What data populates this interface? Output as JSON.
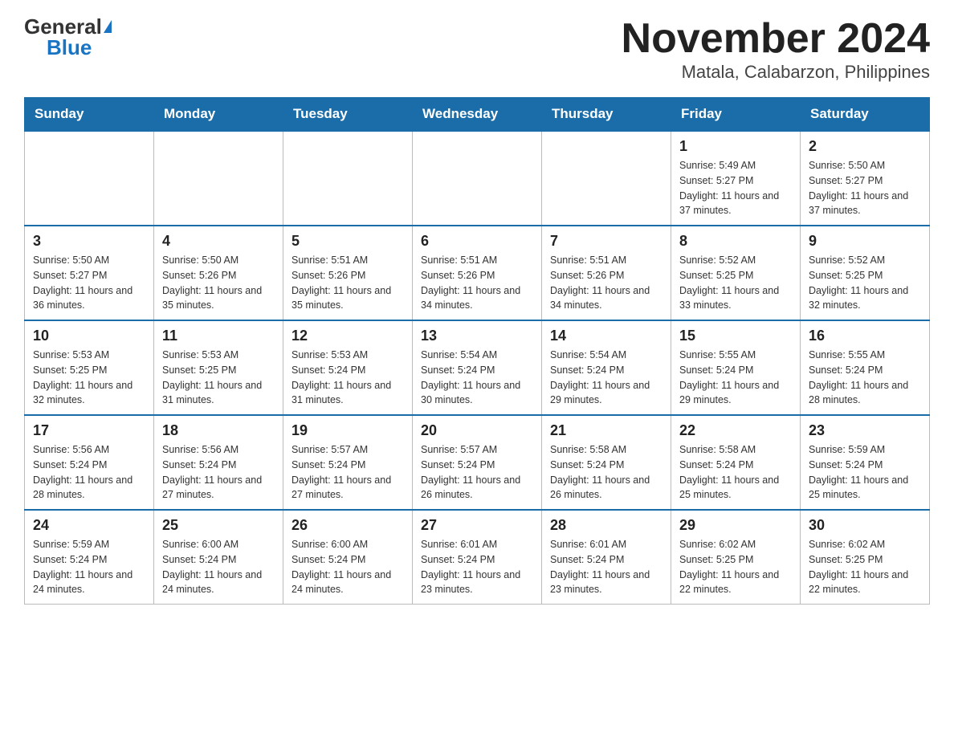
{
  "header": {
    "logo_general": "General",
    "logo_blue": "Blue",
    "title": "November 2024",
    "location": "Matala, Calabarzon, Philippines"
  },
  "weekdays": [
    "Sunday",
    "Monday",
    "Tuesday",
    "Wednesday",
    "Thursday",
    "Friday",
    "Saturday"
  ],
  "weeks": [
    [
      {
        "day": "",
        "info": ""
      },
      {
        "day": "",
        "info": ""
      },
      {
        "day": "",
        "info": ""
      },
      {
        "day": "",
        "info": ""
      },
      {
        "day": "",
        "info": ""
      },
      {
        "day": "1",
        "info": "Sunrise: 5:49 AM\nSunset: 5:27 PM\nDaylight: 11 hours and 37 minutes."
      },
      {
        "day": "2",
        "info": "Sunrise: 5:50 AM\nSunset: 5:27 PM\nDaylight: 11 hours and 37 minutes."
      }
    ],
    [
      {
        "day": "3",
        "info": "Sunrise: 5:50 AM\nSunset: 5:27 PM\nDaylight: 11 hours and 36 minutes."
      },
      {
        "day": "4",
        "info": "Sunrise: 5:50 AM\nSunset: 5:26 PM\nDaylight: 11 hours and 35 minutes."
      },
      {
        "day": "5",
        "info": "Sunrise: 5:51 AM\nSunset: 5:26 PM\nDaylight: 11 hours and 35 minutes."
      },
      {
        "day": "6",
        "info": "Sunrise: 5:51 AM\nSunset: 5:26 PM\nDaylight: 11 hours and 34 minutes."
      },
      {
        "day": "7",
        "info": "Sunrise: 5:51 AM\nSunset: 5:26 PM\nDaylight: 11 hours and 34 minutes."
      },
      {
        "day": "8",
        "info": "Sunrise: 5:52 AM\nSunset: 5:25 PM\nDaylight: 11 hours and 33 minutes."
      },
      {
        "day": "9",
        "info": "Sunrise: 5:52 AM\nSunset: 5:25 PM\nDaylight: 11 hours and 32 minutes."
      }
    ],
    [
      {
        "day": "10",
        "info": "Sunrise: 5:53 AM\nSunset: 5:25 PM\nDaylight: 11 hours and 32 minutes."
      },
      {
        "day": "11",
        "info": "Sunrise: 5:53 AM\nSunset: 5:25 PM\nDaylight: 11 hours and 31 minutes."
      },
      {
        "day": "12",
        "info": "Sunrise: 5:53 AM\nSunset: 5:24 PM\nDaylight: 11 hours and 31 minutes."
      },
      {
        "day": "13",
        "info": "Sunrise: 5:54 AM\nSunset: 5:24 PM\nDaylight: 11 hours and 30 minutes."
      },
      {
        "day": "14",
        "info": "Sunrise: 5:54 AM\nSunset: 5:24 PM\nDaylight: 11 hours and 29 minutes."
      },
      {
        "day": "15",
        "info": "Sunrise: 5:55 AM\nSunset: 5:24 PM\nDaylight: 11 hours and 29 minutes."
      },
      {
        "day": "16",
        "info": "Sunrise: 5:55 AM\nSunset: 5:24 PM\nDaylight: 11 hours and 28 minutes."
      }
    ],
    [
      {
        "day": "17",
        "info": "Sunrise: 5:56 AM\nSunset: 5:24 PM\nDaylight: 11 hours and 28 minutes."
      },
      {
        "day": "18",
        "info": "Sunrise: 5:56 AM\nSunset: 5:24 PM\nDaylight: 11 hours and 27 minutes."
      },
      {
        "day": "19",
        "info": "Sunrise: 5:57 AM\nSunset: 5:24 PM\nDaylight: 11 hours and 27 minutes."
      },
      {
        "day": "20",
        "info": "Sunrise: 5:57 AM\nSunset: 5:24 PM\nDaylight: 11 hours and 26 minutes."
      },
      {
        "day": "21",
        "info": "Sunrise: 5:58 AM\nSunset: 5:24 PM\nDaylight: 11 hours and 26 minutes."
      },
      {
        "day": "22",
        "info": "Sunrise: 5:58 AM\nSunset: 5:24 PM\nDaylight: 11 hours and 25 minutes."
      },
      {
        "day": "23",
        "info": "Sunrise: 5:59 AM\nSunset: 5:24 PM\nDaylight: 11 hours and 25 minutes."
      }
    ],
    [
      {
        "day": "24",
        "info": "Sunrise: 5:59 AM\nSunset: 5:24 PM\nDaylight: 11 hours and 24 minutes."
      },
      {
        "day": "25",
        "info": "Sunrise: 6:00 AM\nSunset: 5:24 PM\nDaylight: 11 hours and 24 minutes."
      },
      {
        "day": "26",
        "info": "Sunrise: 6:00 AM\nSunset: 5:24 PM\nDaylight: 11 hours and 24 minutes."
      },
      {
        "day": "27",
        "info": "Sunrise: 6:01 AM\nSunset: 5:24 PM\nDaylight: 11 hours and 23 minutes."
      },
      {
        "day": "28",
        "info": "Sunrise: 6:01 AM\nSunset: 5:24 PM\nDaylight: 11 hours and 23 minutes."
      },
      {
        "day": "29",
        "info": "Sunrise: 6:02 AM\nSunset: 5:25 PM\nDaylight: 11 hours and 22 minutes."
      },
      {
        "day": "30",
        "info": "Sunrise: 6:02 AM\nSunset: 5:25 PM\nDaylight: 11 hours and 22 minutes."
      }
    ]
  ]
}
